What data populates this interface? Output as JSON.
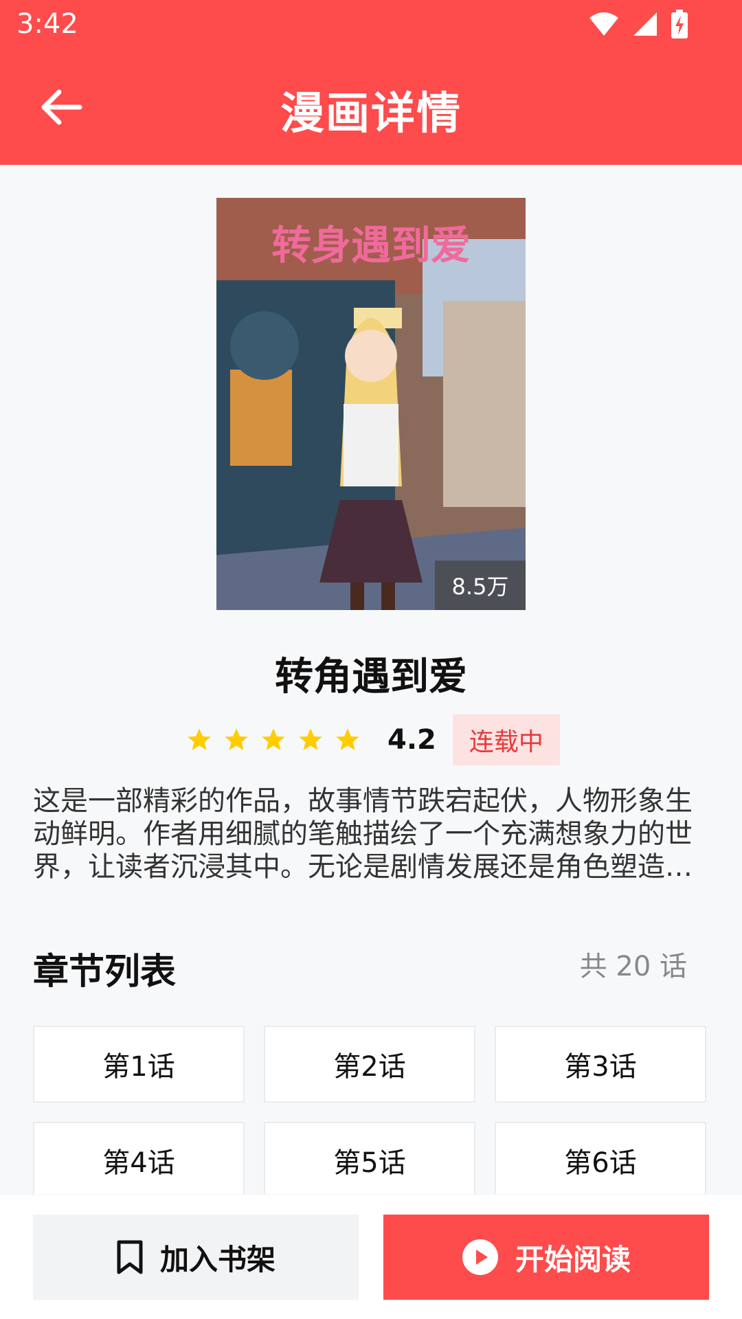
{
  "status_bar": {
    "time": "3:42"
  },
  "header": {
    "title": "漫画详情",
    "back_icon": "arrow-left-icon"
  },
  "cover": {
    "title_text": "转身遇到爱",
    "views": "8.5万"
  },
  "comic": {
    "title": "转角遇到爱",
    "rating": "4.2",
    "rating_stars": 5,
    "status": "连载中",
    "description": "这是一部精彩的作品，故事情节跌宕起伏，人物形象生动鲜明。作者用细腻的笔触描绘了一个充满想象力的世界，让读者沉浸其中。无论是剧情发展还是角色塑造都十分出色。"
  },
  "chapters": {
    "title": "章节列表",
    "count_label": "共 20 话",
    "items": [
      "第1话",
      "第2话",
      "第3话",
      "第4话",
      "第5话",
      "第6话"
    ]
  },
  "actions": {
    "add_shelf": "加入书架",
    "start_reading": "开始阅读"
  },
  "colors": {
    "accent": "#fe4b4b",
    "star": "#ffcc00",
    "tag_bg": "#fde2e2",
    "tag_text": "#e93a3a"
  }
}
